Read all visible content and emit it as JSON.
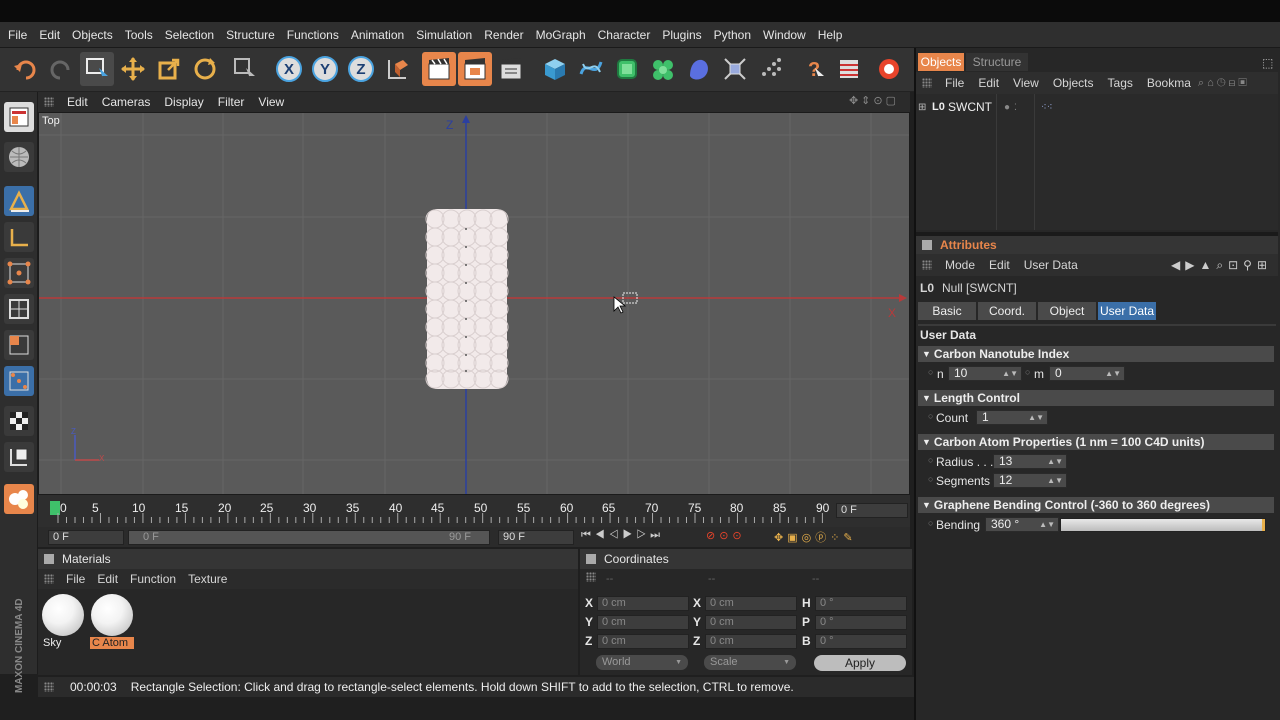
{
  "menu": [
    "File",
    "Edit",
    "Objects",
    "Tools",
    "Selection",
    "Structure",
    "Functions",
    "Animation",
    "Simulation",
    "Render",
    "MoGraph",
    "Character",
    "Plugins",
    "Python",
    "Window",
    "Help"
  ],
  "viewport": {
    "menu": [
      "Edit",
      "Cameras",
      "Display",
      "Filter",
      "View"
    ],
    "view_name": "Top",
    "axis_z": "Z",
    "axis_x": "X"
  },
  "timeline": {
    "ticks": [
      "0",
      "5",
      "10",
      "15",
      "20",
      "25",
      "30",
      "35",
      "40",
      "45",
      "50",
      "55",
      "60",
      "65",
      "70",
      "75",
      "80",
      "85",
      "90"
    ],
    "current_frame": "0 F",
    "start_field": "0 F",
    "range_start": "0 F",
    "range_end": "90 F",
    "end_field": "90 F"
  },
  "materials": {
    "title": "Materials",
    "menu": [
      "File",
      "Edit",
      "Function",
      "Texture"
    ],
    "items": [
      {
        "name": "Sky",
        "selected": false
      },
      {
        "name": "C Atom",
        "selected": true
      }
    ]
  },
  "coordinates": {
    "title": "Coordinates",
    "headers": [
      "--",
      "--",
      "--"
    ],
    "rows": [
      {
        "a_label": "X",
        "a_val": "0 cm",
        "b_label": "X",
        "b_val": "0 cm",
        "c_label": "H",
        "c_val": "0 °"
      },
      {
        "a_label": "Y",
        "a_val": "0 cm",
        "b_label": "Y",
        "b_val": "0 cm",
        "c_label": "P",
        "c_val": "0 °"
      },
      {
        "a_label": "Z",
        "a_val": "0 cm",
        "b_label": "Z",
        "b_val": "0 cm",
        "c_label": "B",
        "c_val": "0 °"
      }
    ],
    "world": "World",
    "scale": "Scale",
    "apply": "Apply"
  },
  "status": {
    "time": "00:00:03",
    "message": "Rectangle Selection: Click and drag to rectangle-select elements. Hold down SHIFT to add to the selection, CTRL to remove."
  },
  "brand": "MAXON CINEMA 4D",
  "objects": {
    "tabs": [
      "Objects",
      "Structure"
    ],
    "menu": [
      "File",
      "Edit",
      "View",
      "Objects",
      "Tags",
      "Bookma"
    ],
    "items": [
      {
        "name": "SWCNT",
        "icon": "L0"
      }
    ]
  },
  "attributes": {
    "title": "Attributes",
    "menu": [
      "Mode",
      "Edit",
      "User Data"
    ],
    "object_icon": "L0",
    "object_label": "Null [SWCNT]",
    "tabs": [
      "Basic",
      "Coord.",
      "Object",
      "User Data"
    ],
    "section": "User Data",
    "groups": [
      {
        "title": "Carbon Nanotube Index"
      },
      {
        "title": "Length Control"
      },
      {
        "title": "Carbon Atom Properties (1 nm = 100 C4D units)"
      },
      {
        "title": "Graphene Bending Control (-360 to 360 degrees)"
      }
    ],
    "params": {
      "n_label": "n",
      "n_val": "10",
      "m_label": "m",
      "m_val": "0",
      "count_label": "Count",
      "count_val": "1",
      "radius_label": "Radius . . .",
      "radius_val": "13",
      "segments_label": "Segments",
      "segments_val": "12",
      "bending_label": "Bending",
      "bending_val": "360 °",
      "bending_fraction": 1.0
    }
  },
  "colors": {
    "accent_orange": "#e8864b",
    "selection_blue": "#3b6fa8",
    "viewport_bg": "#5a5a5a",
    "axis_blue": "#2b3fa0",
    "axis_red": "#b83a3a"
  }
}
